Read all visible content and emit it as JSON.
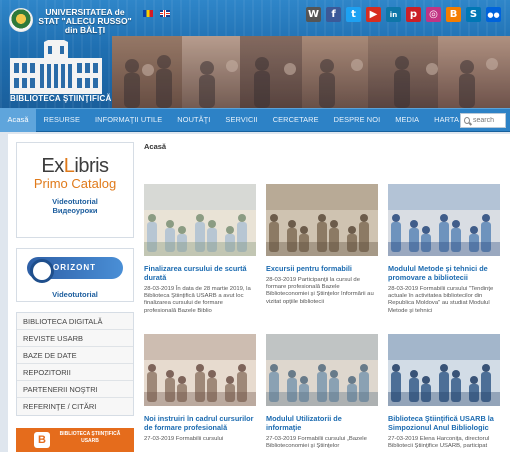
{
  "header": {
    "university_name": "UNIVERSITATEA de STAT \"ALECU RUSSO\" din BĂLŢI",
    "library_title": "BIBLIOTECA ŞTIINŢIFICĂ",
    "social": [
      {
        "icon": "wikipedia-icon",
        "glyph": "W",
        "color": "#555555"
      },
      {
        "icon": "facebook-icon",
        "glyph": "f",
        "color": "#3b5998"
      },
      {
        "icon": "twitter-icon",
        "glyph": "t",
        "color": "#1da1f2"
      },
      {
        "icon": "youtube-icon",
        "glyph": "▶",
        "color": "#d62d20"
      },
      {
        "icon": "linkedin-icon",
        "glyph": "in",
        "color": "#0e76a8"
      },
      {
        "icon": "pinterest-icon",
        "glyph": "p",
        "color": "#cb2027"
      },
      {
        "icon": "instagram-icon",
        "glyph": "◎",
        "color": "#c13584"
      },
      {
        "icon": "blogger-icon",
        "glyph": "B",
        "color": "#f57d00"
      },
      {
        "icon": "slideshare-icon",
        "glyph": "S",
        "color": "#0077b5"
      },
      {
        "icon": "flickr-icon",
        "glyph": "●●",
        "color": "#0063dc"
      }
    ]
  },
  "nav": {
    "items": [
      "Acasă",
      "RESURSE",
      "INFORMAŢII UTILE",
      "NOUTĂŢI",
      "SERVICII",
      "CERCETARE",
      "DESPRE NOI",
      "MEDIA",
      "HARTA"
    ],
    "search_placeholder": "search"
  },
  "sidebar": {
    "exlibris_title": "ExLibris",
    "exlibris_sub": "Primo Catalog",
    "videotutorial": "Videotutorial",
    "videotutorial_ru": "Видеоуроки",
    "orizont_text": "ORIZONT",
    "orizont_video": "Videotutorial",
    "links": [
      "BIBLIOTECA DIGITALĂ",
      "REVISTE USARB",
      "BAZE DE DATE",
      "REPOZITORII",
      "PARTENERII NOŞTRI",
      "REFERINŢE / CITĂRI"
    ],
    "blog_text": "BIBLIOTECA ŞTIINŢIFICĂ USARB"
  },
  "main": {
    "breadcrumb": "Acasă",
    "articles": [
      {
        "title": "Finalizarea cursului de scurtă durată",
        "text": "28-03-2019 În data de 28 martie 2019, la Biblioteca Ştiinţifică USARB a avut loc finalizarea cursului de formare profesională Bazele Biblio"
      },
      {
        "title": "Excursii pentru formabili",
        "text": "28-03-2019 Participanţii la cursul de formare profesională Bazele Biblioteconomiei şi Ştiinţelor Informării au vizitat opţiile bibliotecii"
      },
      {
        "title": "Modulul Metode şi tehnici de promovare a bibliotecii",
        "text": "28-03-2019 Formabilii cursului \"Tendinţe actuale în activitatea bibliotecilor din Republica Moldova\" au studiat Modulul Metode şi tehnici"
      },
      {
        "title": "Noi instruiri în cadrul cursurilor de formare profesională",
        "text": "27-03-2019 Formabilii cursului"
      },
      {
        "title": "Modulul Utilizatorii de informaţie",
        "text": "27-03-2019 Formabilii cursului „Bazele Biblioteconomiei şi Ştiinţelor"
      },
      {
        "title": "Biblioteca Ştiinţifică USARB la Simpozionul Anul Bibliologic",
        "text": "27-03-2019 Elena Harconiţa, directorul Bibliotecii Ştiinţifice USARB, participat"
      }
    ]
  }
}
